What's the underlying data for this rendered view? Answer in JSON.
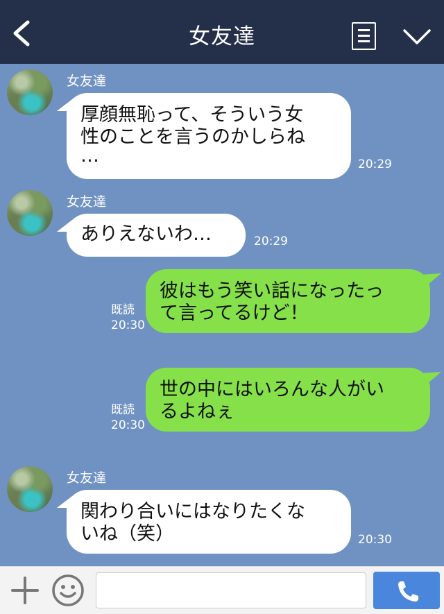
{
  "header": {
    "title": "女友達",
    "back_icon": "chevron-left-icon",
    "menu_icon": "list-icon",
    "collapse_icon": "chevron-down-icon"
  },
  "messages": [
    {
      "side": "in",
      "sender": "女友達",
      "line1": "厚顔無恥って、そういう女",
      "line2": "性のことを言うのかしらね",
      "line3": "…",
      "time": "20:29"
    },
    {
      "side": "in",
      "sender": "女友達",
      "line1": "ありえないわ…",
      "time": "20:29"
    },
    {
      "side": "out",
      "read": "既読",
      "line1": "彼はもう笑い話になったっ",
      "line2": "て言ってるけど！",
      "time": "20:30"
    },
    {
      "side": "out",
      "read": "既読",
      "line1": "世の中にはいろんな人がい",
      "line2": "るよねぇ",
      "time": "20:30"
    },
    {
      "side": "in",
      "sender": "女友達",
      "line1": "関わり合いにはなりたくな",
      "line2": "いね（笑）",
      "time": "20:30"
    }
  ],
  "footer": {
    "plus_icon": "plus-icon",
    "emoji_icon": "smiley-icon",
    "input_placeholder": "",
    "call_icon": "phone-icon"
  },
  "colors": {
    "header_bg": "#24304a",
    "chat_bg": "#7092c2",
    "incoming_bubble": "#ffffff",
    "outgoing_bubble": "#86e04a",
    "call_button": "#4a87dc"
  }
}
